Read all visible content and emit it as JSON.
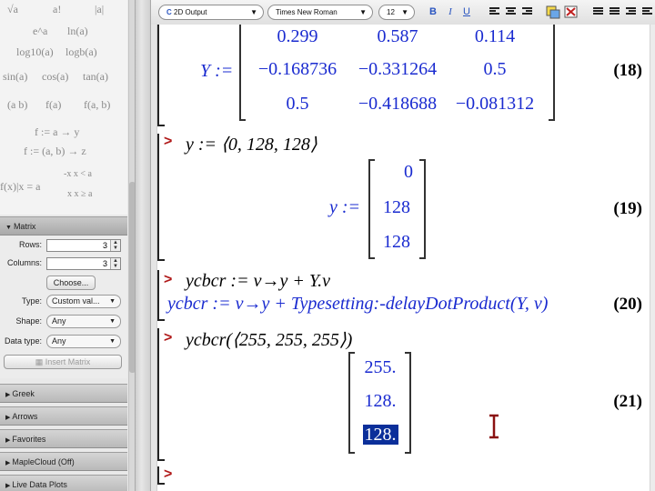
{
  "expression_palette": {
    "items": [
      "√a",
      "a!",
      "|a|",
      "e^a",
      "ln(a)",
      "log10(a)",
      "logb(a)",
      "sin(a)",
      "cos(a)",
      "tan(a)",
      "(a b)",
      "f(a)",
      "f(a, b)",
      "f := a → y",
      "f := (a, b) → z",
      "f(x)|x = a",
      "-x  x < a",
      "x  x ≥ a"
    ]
  },
  "matrix_palette": {
    "header": "Matrix",
    "rows_label": "Rows:",
    "rows_value": "3",
    "columns_label": "Columns:",
    "columns_value": "3",
    "choose_button": "Choose...",
    "type_label": "Type:",
    "type_value": "Custom val...",
    "shape_label": "Shape:",
    "shape_value": "Any",
    "datatype_label": "Data type:",
    "datatype_value": "Any",
    "insert_button": "Insert Matrix"
  },
  "palettes": [
    "Greek",
    "Arrows",
    "Favorites",
    "MapleCloud (Off)",
    "Live Data Plots"
  ],
  "toolbar": {
    "mode": "2D Output",
    "font": "Times New Roman",
    "size": "12",
    "bold": "B",
    "italic": "I",
    "underline": "U"
  },
  "worksheet": {
    "prompt_symbol": ">",
    "eq18": {
      "lhs": "Y :=",
      "rows": [
        [
          "0.299",
          "0.587",
          "0.114"
        ],
        [
          "−0.168736",
          "−0.331264",
          "0.5"
        ],
        [
          "0.5",
          "−0.418688",
          "−0.081312"
        ]
      ],
      "label": "(18)"
    },
    "cmd19": "y := ⟨0, 128, 128⟩",
    "eq19": {
      "lhs": "y :=",
      "values": [
        "0",
        "128",
        "128"
      ],
      "label": "(19)"
    },
    "cmd20": "ycbcr := v→y + Y.v",
    "eq20": {
      "text": "ycbcr := v→y + Typesetting:-delayDotProduct(Y, v)",
      "label": "(20)"
    },
    "cmd21": "ycbcr(⟨255, 255, 255⟩)",
    "eq21": {
      "values": [
        "255.",
        "128.",
        "128."
      ],
      "label": "(21)"
    }
  }
}
